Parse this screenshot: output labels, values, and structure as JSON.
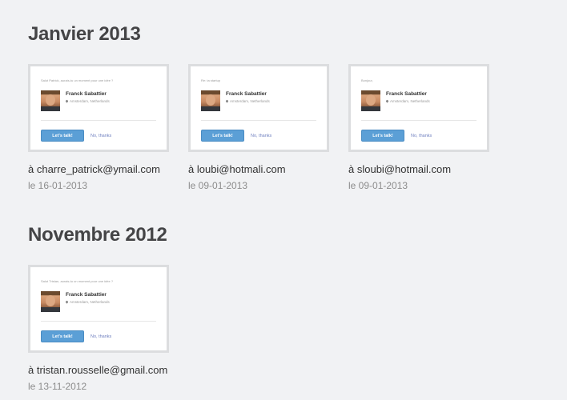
{
  "sections": [
    {
      "title": "Janvier 2013",
      "cards": [
        {
          "message": "Salut Patrick, aurais-tu un moment pour une idée ?",
          "name": "Franck Sabattier",
          "location": "Amsterdam, Netherlands",
          "cta": "Let's talk!",
          "decline": "No, thanks",
          "recipient": "à charre_patrick@ymail.com",
          "date": "le 16-01-2013"
        },
        {
          "message": "Re: ta startup",
          "name": "Franck Sabattier",
          "location": "Amsterdam, Netherlands",
          "cta": "Let's talk!",
          "decline": "No, thanks",
          "recipient": "à loubi@hotmali.com",
          "date": "le 09-01-2013"
        },
        {
          "message": "Bonjour,",
          "name": "Franck Sabattier",
          "location": "Amsterdam, Netherlands",
          "cta": "Let's talk!",
          "decline": "No, thanks",
          "recipient": "à sloubi@hotmail.com",
          "date": "le 09-01-2013"
        }
      ]
    },
    {
      "title": "Novembre 2012",
      "cards": [
        {
          "message": "Salut Tristan, aurais-tu un moment pour une idée ?",
          "name": "Franck Sabattier",
          "location": "Amsterdam, Netherlands",
          "cta": "Let's talk!",
          "decline": "No, thanks",
          "recipient": "à tristan.rousselle@gmail.com",
          "date": "le 13-11-2012"
        }
      ]
    }
  ]
}
